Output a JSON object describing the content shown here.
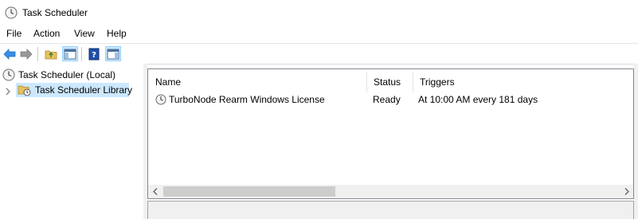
{
  "window": {
    "title": "Task Scheduler"
  },
  "menu": [
    "File",
    "Action",
    "View",
    "Help"
  ],
  "toolbar": {
    "buttons": [
      "back-icon",
      "forward-icon",
      "up-folder-icon",
      "show-hide-console-tree-icon",
      "help-icon",
      "show-hide-action-pane-icon"
    ]
  },
  "tree": {
    "root": "Task Scheduler (Local)",
    "library": "Task Scheduler Library"
  },
  "list": {
    "columns": [
      "Name",
      "Status",
      "Triggers"
    ],
    "rows": [
      {
        "name": "TurboNode Rearm Windows License",
        "status": "Ready",
        "triggers": "At 10:00 AM every 181 days"
      }
    ]
  },
  "colors": {
    "selection": "#cce8ff",
    "pane_bg": "#f0f0f0",
    "border": "#828790"
  }
}
